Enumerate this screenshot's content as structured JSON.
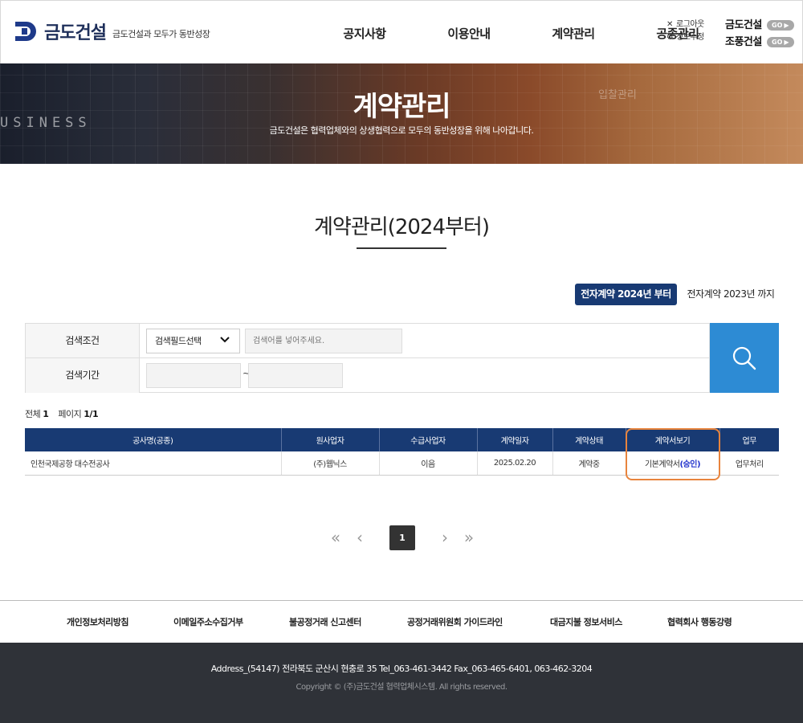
{
  "header": {
    "logo_name": "금도건설",
    "logo_slogan": "금도건설과 모두가 동반성장",
    "nav": [
      "공지사항",
      "이용안내",
      "계약관리",
      "공종관리"
    ],
    "util": {
      "logout": "로그아웃",
      "edit_info": "정보수정"
    },
    "companies": [
      {
        "name": "금도건설",
        "go": "GO"
      },
      {
        "name": "조풍건설",
        "go": "GO"
      }
    ]
  },
  "banner": {
    "title": "계약관리",
    "subtitle": "금도건설은 협력업체와의 상생협력으로 모두의 동반성장을 위해 나아갑니다.",
    "bg_text": "USINESS",
    "ghost_text": "입찰관리"
  },
  "page_title": "계약관리(2024부터)",
  "tabs": {
    "active": "전자계약 2024년 부터",
    "other": "전자계약 2023년 까지"
  },
  "search": {
    "cond_label": "검색조건",
    "period_label": "검색기간",
    "field_select": "검색필드선택",
    "keyword_placeholder": "검색어를 넣어주세요.",
    "date_from": "",
    "date_to": "",
    "tilde": "~"
  },
  "summary": {
    "total_label": "전체",
    "total": "1",
    "page_label": "페이지",
    "page": "1/1"
  },
  "table": {
    "headers": [
      "공사명(공종)",
      "원사업자",
      "수급사업자",
      "계약일자",
      "계약상태",
      "계약서보기",
      "업무"
    ],
    "rows": [
      {
        "project": "인천국제공항 대수전공사",
        "principal": "(주)웹닉스",
        "contractor": "이음",
        "date": "2025.02.20",
        "status": "계약중",
        "doc": "기본계약서",
        "doc_status": "(승인)",
        "action": "업무처리"
      }
    ]
  },
  "pager": {
    "first": "«",
    "prev": "‹",
    "current": "1",
    "next": "›",
    "last": "»"
  },
  "footer": {
    "links": [
      "개인정보처리방침",
      "이메일주소수집거부",
      "불공정거래 신고센터",
      "공정거래위원회 가이드라인",
      "대금지불 정보서비스",
      "협력회사 행동강령"
    ],
    "address": "Address_(54147) 전라북도 군산시 현충로 35   Tel_063-461-3442   Fax_063-465-6401, 063-462-3204",
    "copyright": "Copyright © (주)금도건설 협력업체시스템. All rights reserved."
  },
  "colors": {
    "navy": "#183a73",
    "search_blue": "#2d8bd4",
    "highlight": "#e8843d",
    "footer_bg": "#2f3238"
  }
}
